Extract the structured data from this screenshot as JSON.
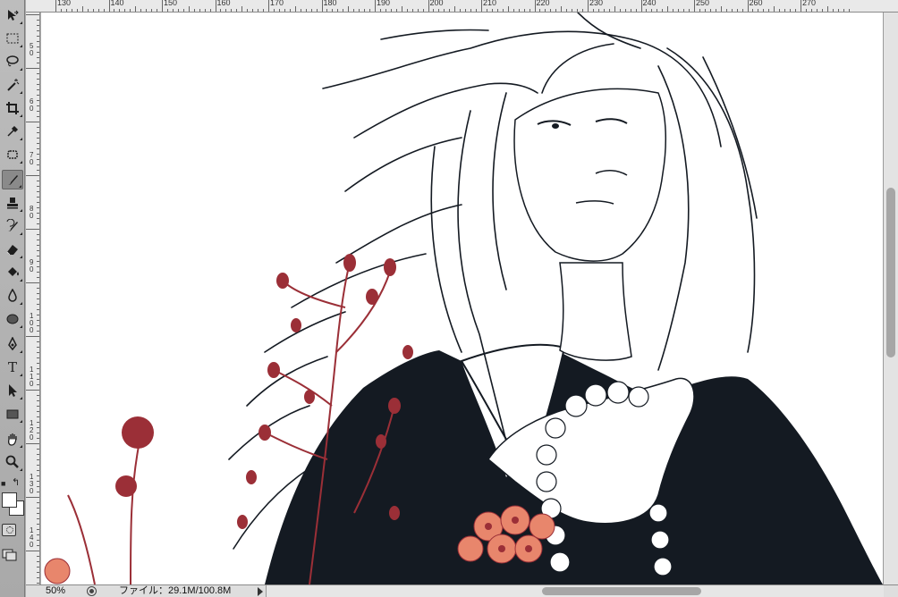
{
  "tools": [
    {
      "name": "move-tool",
      "icon": "move-icon"
    },
    {
      "name": "marquee-tool",
      "icon": "marquee-icon"
    },
    {
      "name": "lasso-tool",
      "icon": "lasso-icon"
    },
    {
      "name": "magic-wand-tool",
      "icon": "magic-wand-icon"
    },
    {
      "name": "crop-tool",
      "icon": "crop-icon"
    },
    {
      "name": "eyedropper-tool",
      "icon": "eyedropper-icon"
    },
    {
      "name": "spot-healing-tool",
      "icon": "bandage-icon"
    },
    {
      "name": "brush-tool",
      "icon": "brush-icon",
      "active": true
    },
    {
      "name": "clone-stamp-tool",
      "icon": "stamp-icon"
    },
    {
      "name": "history-brush-tool",
      "icon": "history-brush-icon"
    },
    {
      "name": "eraser-tool",
      "icon": "eraser-icon"
    },
    {
      "name": "paint-bucket-tool",
      "icon": "bucket-icon"
    },
    {
      "name": "blur-tool",
      "icon": "drop-icon"
    },
    {
      "name": "dodge-tool",
      "icon": "sponge-icon"
    },
    {
      "name": "pen-tool",
      "icon": "pen-icon"
    },
    {
      "name": "type-tool",
      "icon": "type-icon",
      "label": "T"
    },
    {
      "name": "path-selection-tool",
      "icon": "arrow-icon"
    },
    {
      "name": "rectangle-tool",
      "icon": "rectangle-icon"
    },
    {
      "name": "hand-tool",
      "icon": "hand-icon"
    },
    {
      "name": "zoom-tool",
      "icon": "magnifier-icon"
    }
  ],
  "colors": {
    "foreground": "#ffffff",
    "background": "#ffffff",
    "ink": "#141a22",
    "flower_red": "#9b2f37",
    "flower_orange": "#e8866c"
  },
  "ruler_top": [
    "130",
    "140",
    "150",
    "160",
    "170",
    "180",
    "190",
    "200",
    "210",
    "220",
    "230",
    "240",
    "250",
    "260",
    "270"
  ],
  "ruler_left": [
    "5",
    "0",
    "6",
    "0",
    "7",
    "0",
    "8",
    "0",
    "9",
    "0",
    "1",
    "0",
    "0",
    "1",
    "1",
    "0",
    "1",
    "2",
    "0",
    "1",
    "3",
    "0",
    "1",
    "4",
    "0"
  ],
  "status": {
    "zoom": "50%",
    "file_info": "ファイル：29.1M/100.8M"
  }
}
